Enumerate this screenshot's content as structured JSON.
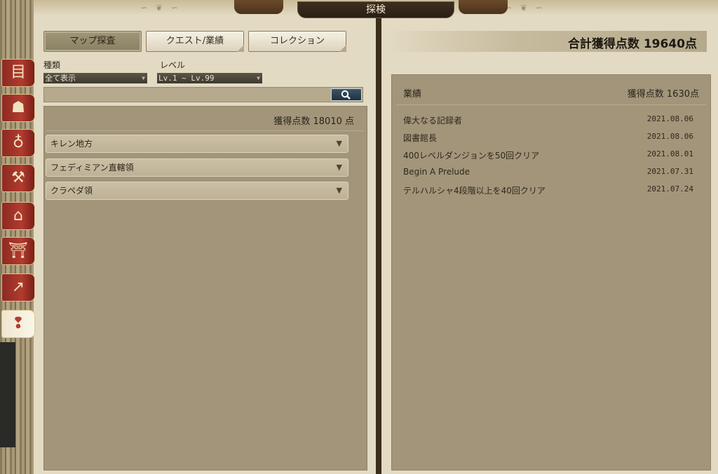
{
  "window": {
    "title": "探検"
  },
  "tabs": [
    {
      "label": "マップ探査",
      "active": true
    },
    {
      "label": "クエスト/業績",
      "active": false
    },
    {
      "label": "コレクション",
      "active": false
    }
  ],
  "filters": {
    "type_label": "種類",
    "type_value": "全て表示",
    "level_label": "レベル",
    "level_value": "Lv.1 ~ Lv.99"
  },
  "left_panel": {
    "score_label": "獲得点数 18010 点",
    "regions": [
      {
        "name": "キレン地方"
      },
      {
        "name": "フェディミアン直轄領"
      },
      {
        "name": "クラペダ領"
      }
    ]
  },
  "right_panel": {
    "total_label": "合計獲得点数 19640点",
    "section_title": "業績",
    "section_score": "獲得点数 1630点",
    "achievements": [
      {
        "name": "偉大なる記録者",
        "date": "2021.08.06"
      },
      {
        "name": "図書館長",
        "date": "2021.08.06"
      },
      {
        "name": "400レベルダンジョンを50回クリア",
        "date": "2021.08.01"
      },
      {
        "name": "Begin A Prelude",
        "date": "2021.07.31"
      },
      {
        "name": "テルハルシャ4段階以上を40回クリア",
        "date": "2021.07.24"
      }
    ]
  },
  "side_tabs": [
    {
      "icon": "journal-icon",
      "glyph": "目"
    },
    {
      "icon": "monster-icon",
      "glyph": "☗"
    },
    {
      "icon": "potion-icon",
      "glyph": "♁"
    },
    {
      "icon": "anvil-icon",
      "glyph": "⚒"
    },
    {
      "icon": "house-icon",
      "glyph": "⌂"
    },
    {
      "icon": "shrine-icon",
      "glyph": "⛩"
    },
    {
      "icon": "chart-icon",
      "glyph": "↗"
    },
    {
      "icon": "footprints-icon",
      "glyph": "❢"
    }
  ],
  "colors": {
    "side_tab_red": "#b23b2e",
    "panel": "#a2957a",
    "page": "#e3dac3"
  }
}
